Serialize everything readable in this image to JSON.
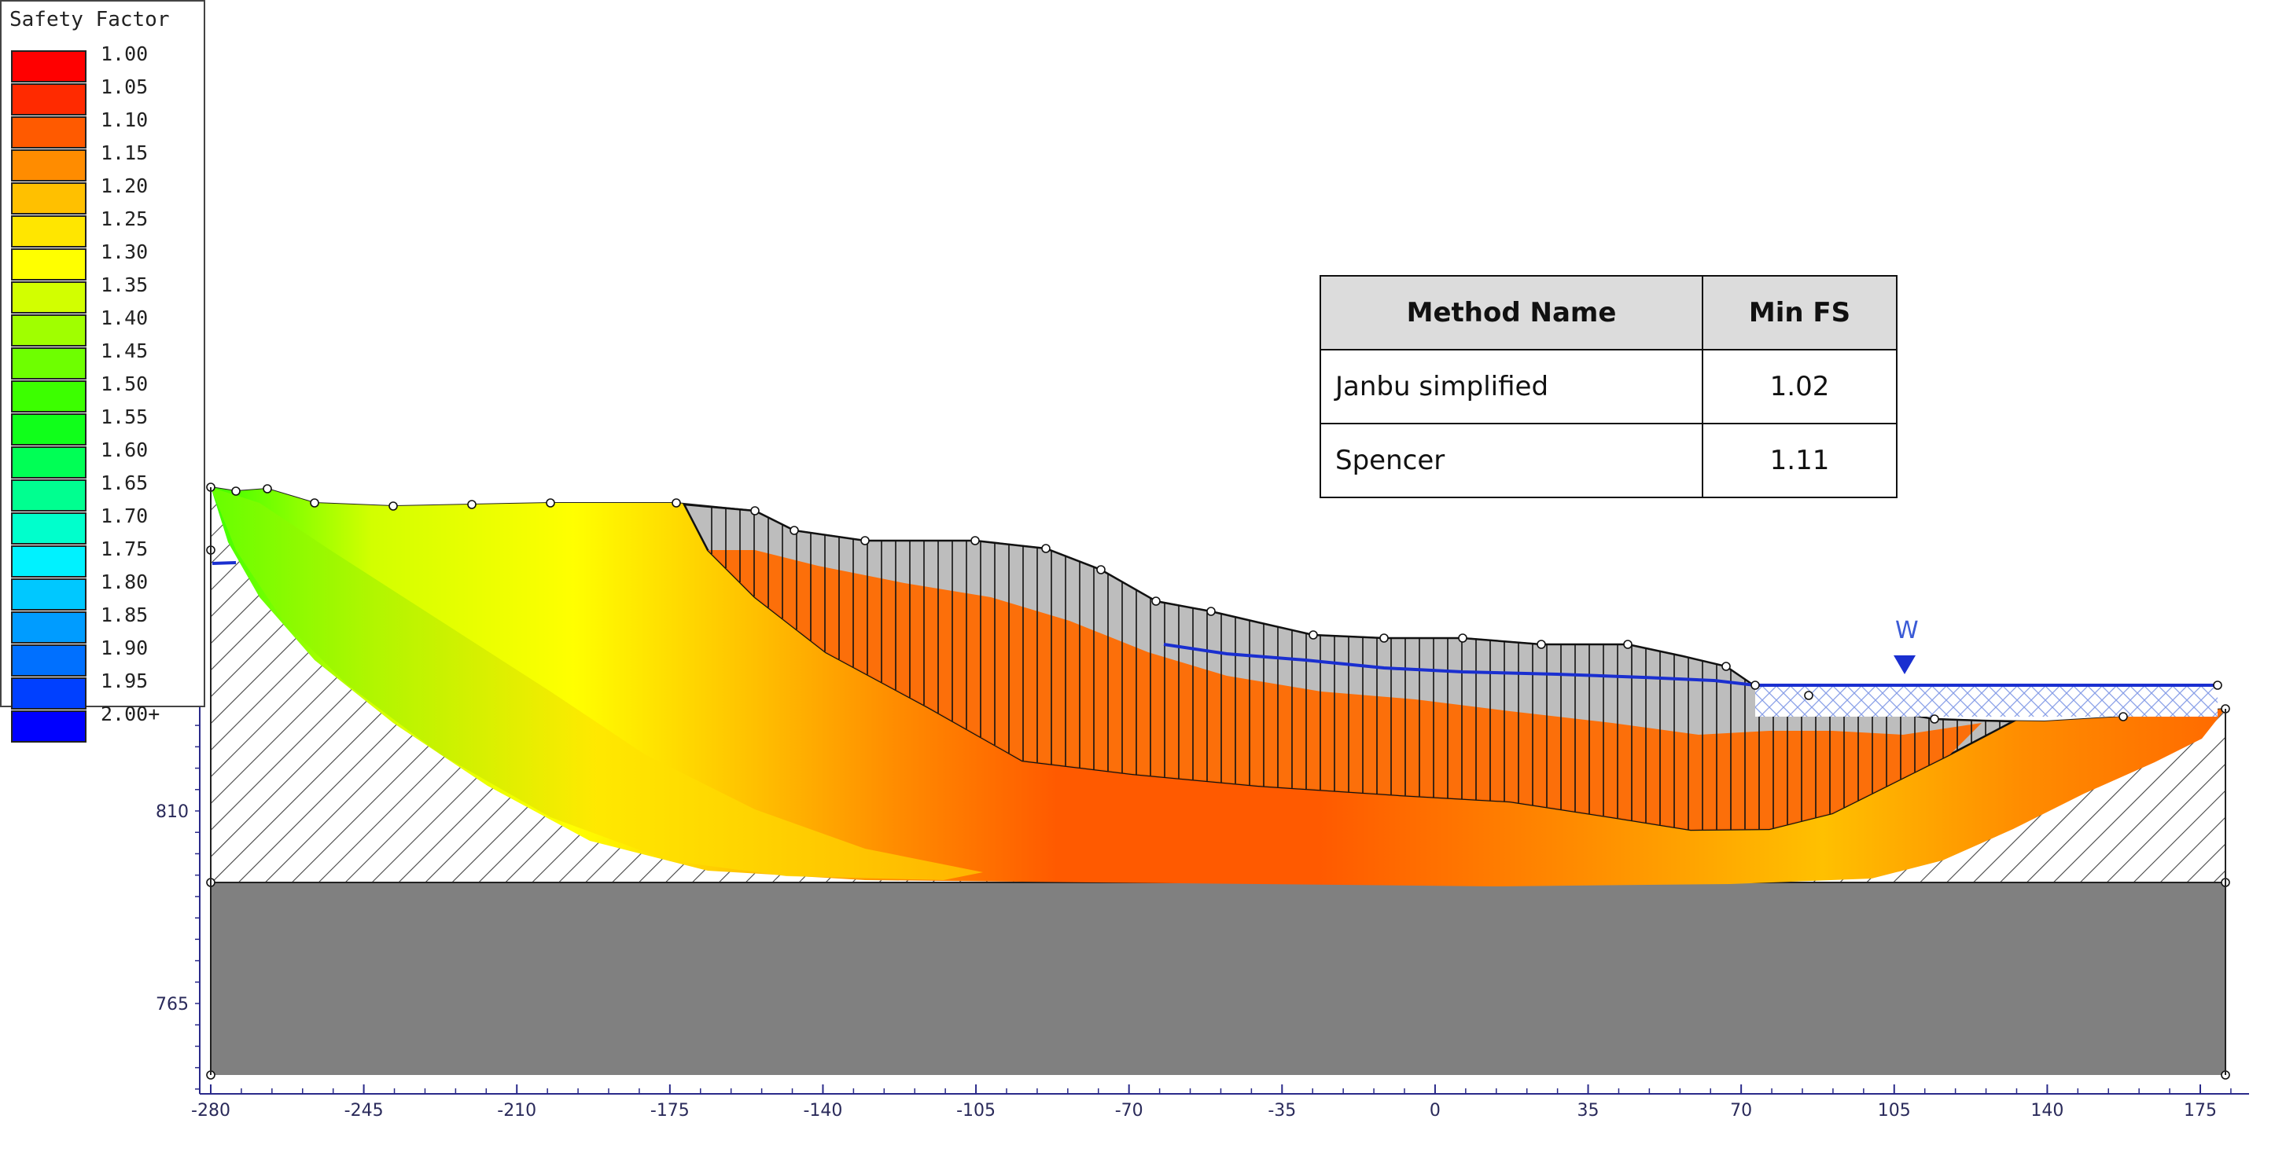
{
  "legend": {
    "title": "Safety Factor",
    "entries": [
      {
        "label": "1.00",
        "color": "#ff0000"
      },
      {
        "label": "1.05",
        "color": "#ff2a00"
      },
      {
        "label": "1.10",
        "color": "#ff5a00"
      },
      {
        "label": "1.15",
        "color": "#ff8c00"
      },
      {
        "label": "1.20",
        "color": "#ffc000"
      },
      {
        "label": "1.25",
        "color": "#ffe600"
      },
      {
        "label": "1.30",
        "color": "#ffff00"
      },
      {
        "label": "1.35",
        "color": "#d2ff00"
      },
      {
        "label": "1.40",
        "color": "#a0ff00"
      },
      {
        "label": "1.45",
        "color": "#6eff00"
      },
      {
        "label": "1.50",
        "color": "#3cff00"
      },
      {
        "label": "1.55",
        "color": "#10ff1a"
      },
      {
        "label": "1.60",
        "color": "#00ff55"
      },
      {
        "label": "1.65",
        "color": "#00ff90"
      },
      {
        "label": "1.70",
        "color": "#00ffcc"
      },
      {
        "label": "1.75",
        "color": "#00f2ff"
      },
      {
        "label": "1.80",
        "color": "#00c8ff"
      },
      {
        "label": "1.85",
        "color": "#009cff"
      },
      {
        "label": "1.90",
        "color": "#0070ff"
      },
      {
        "label": "1.95",
        "color": "#0040ff"
      },
      {
        "label": "2.00+",
        "color": "#0000ff"
      }
    ]
  },
  "results_table": {
    "headers": [
      "Method Name",
      "Min FS"
    ],
    "rows": [
      {
        "method": "Janbu simplified",
        "min_fs": "1.02"
      },
      {
        "method": "Spencer",
        "min_fs": "1.11"
      }
    ]
  },
  "axes": {
    "x_ticks": [
      "-280",
      "-245",
      "-210",
      "-175",
      "-140",
      "-105",
      "-70",
      "-35",
      "0",
      "35",
      "70",
      "105",
      "140",
      "175"
    ],
    "y_ticks": [
      "810",
      "765"
    ]
  },
  "water_marker": {
    "label": "W"
  },
  "colors": {
    "bedrock": "#808080",
    "water_table": "#1a2fd0",
    "sliding_mass_fill": "#bdbdbd",
    "axis": "#2a2a8a"
  }
}
